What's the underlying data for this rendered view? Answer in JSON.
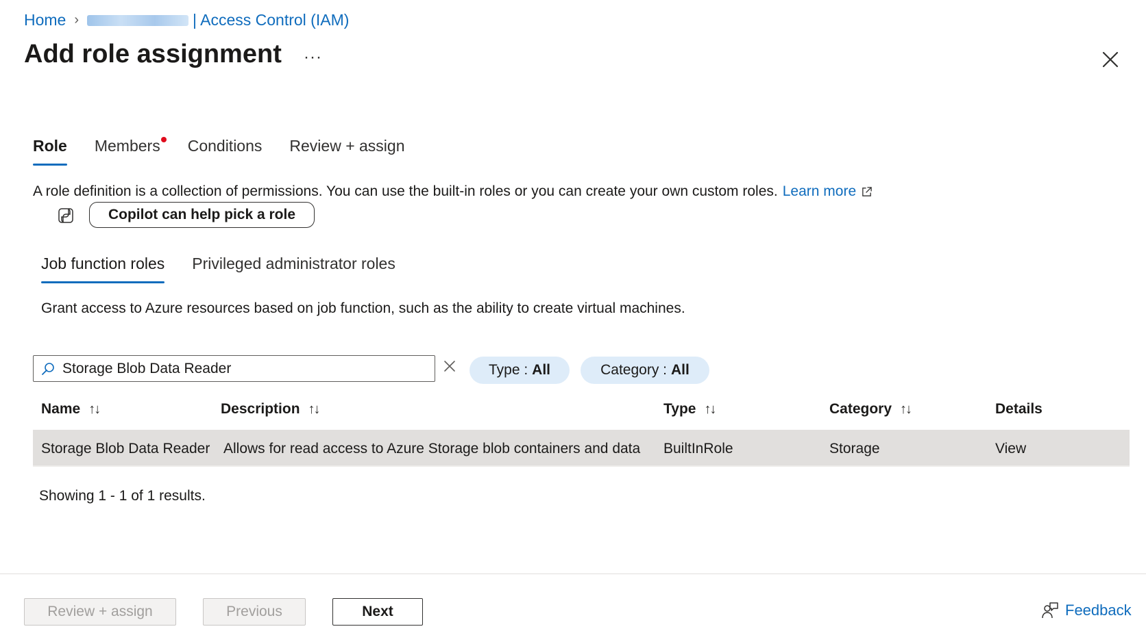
{
  "breadcrumb": {
    "home": "Home",
    "current": "| Access Control (IAM)"
  },
  "header": {
    "title": "Add role assignment",
    "more": "···"
  },
  "tabs": [
    {
      "label": "Role"
    },
    {
      "label": "Members"
    },
    {
      "label": "Conditions"
    },
    {
      "label": "Review + assign"
    }
  ],
  "role_description": {
    "text": "A role definition is a collection of permissions. You can use the built-in roles or you can create your own custom roles.",
    "link": "Learn more"
  },
  "copilot": {
    "label": "Copilot can help pick a role"
  },
  "subtabs": [
    {
      "label": "Job function roles"
    },
    {
      "label": "Privileged administrator roles"
    }
  ],
  "subtab_description": "Grant access to Azure resources based on job function, such as the ability to create virtual machines.",
  "search": {
    "value": "Storage Blob Data Reader"
  },
  "filters": {
    "type": {
      "label": "Type :",
      "value": "All"
    },
    "category": {
      "label": "Category :",
      "value": "All"
    }
  },
  "table": {
    "columns": [
      "Name",
      "Description",
      "Type",
      "Category",
      "Details"
    ],
    "rows": [
      {
        "name": "Storage Blob Data Reader",
        "description": "Allows for read access to Azure Storage blob containers and data",
        "type": "BuiltInRole",
        "category": "Storage",
        "details": "View"
      }
    ]
  },
  "results": "Showing 1 - 1 of 1 results.",
  "footer": {
    "review_assign": "Review + assign",
    "previous": "Previous",
    "next": "Next",
    "feedback": "Feedback"
  },
  "colors": {
    "accent": "#0f6cbd",
    "required_dot": "#e00b1c",
    "pill_bg": "#deecf9",
    "selected_row": "#e1dfdd"
  }
}
